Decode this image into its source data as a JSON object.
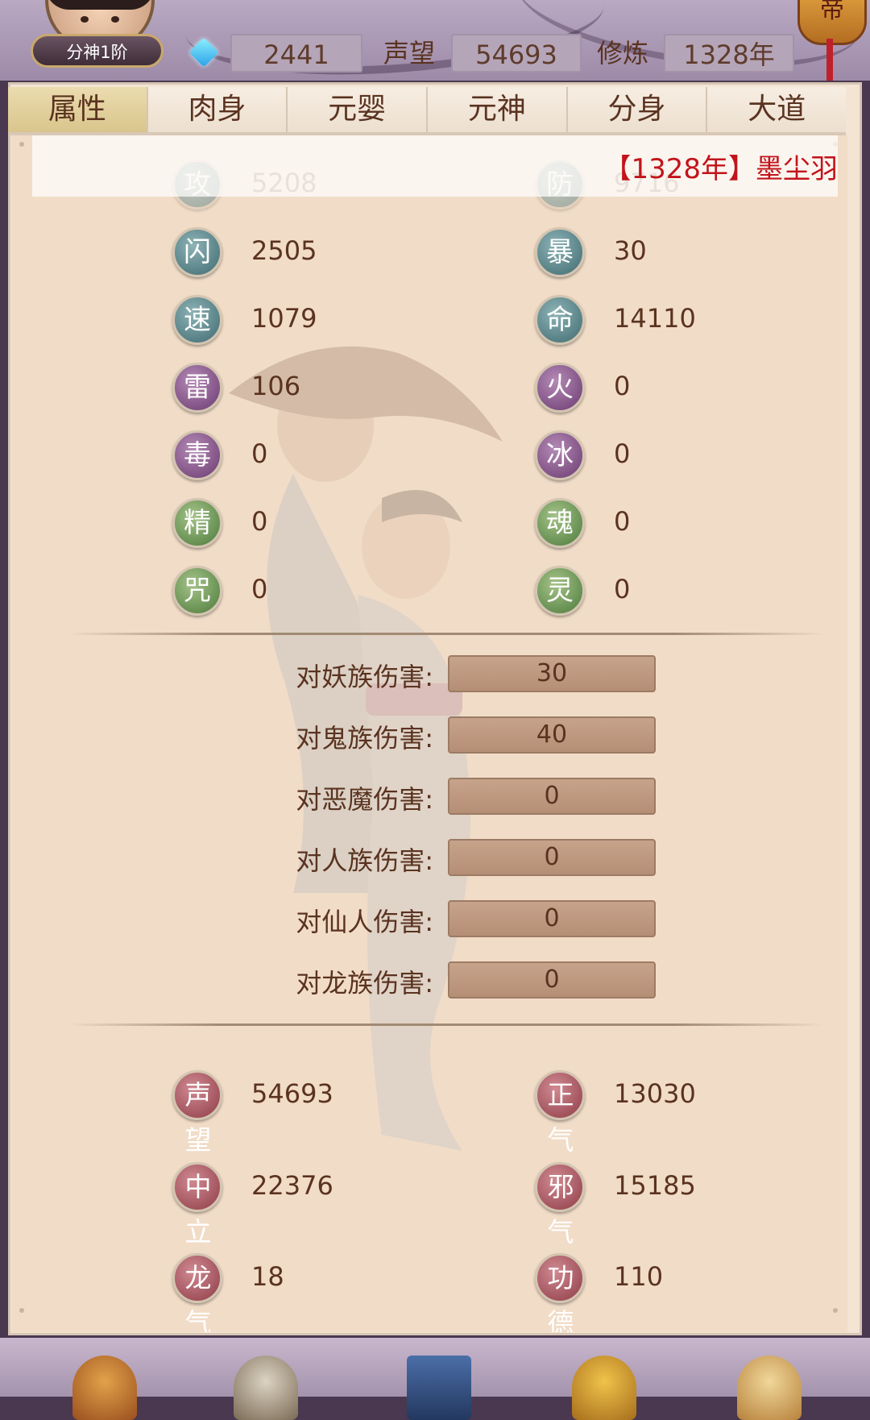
{
  "header": {
    "rank_badge": "分神1阶",
    "gems": "2441",
    "prestige_label": "声望",
    "prestige_value": "54693",
    "cultivation_label": "修炼",
    "cultivation_value": "1328年",
    "lantern_text": "帝"
  },
  "tabs": [
    {
      "label": "属性",
      "active": true
    },
    {
      "label": "肉身",
      "active": false
    },
    {
      "label": "元婴",
      "active": false
    },
    {
      "label": "元神",
      "active": false
    },
    {
      "label": "分身",
      "active": false
    },
    {
      "label": "大道",
      "active": false
    }
  ],
  "ticker": "【1328年】墨尘羽",
  "stats": [
    {
      "icon": "攻",
      "value": "5208",
      "color": "teal"
    },
    {
      "icon": "防",
      "value": "9716",
      "color": "teal"
    },
    {
      "icon": "闪",
      "value": "2505",
      "color": "teal"
    },
    {
      "icon": "暴",
      "value": "30",
      "color": "teal"
    },
    {
      "icon": "速",
      "value": "1079",
      "color": "teal"
    },
    {
      "icon": "命",
      "value": "14110",
      "color": "teal"
    },
    {
      "icon": "雷",
      "value": "106",
      "color": "purple"
    },
    {
      "icon": "火",
      "value": "0",
      "color": "purple"
    },
    {
      "icon": "毒",
      "value": "0",
      "color": "purple"
    },
    {
      "icon": "冰",
      "value": "0",
      "color": "purple"
    },
    {
      "icon": "精",
      "value": "0",
      "color": "green"
    },
    {
      "icon": "魂",
      "value": "0",
      "color": "green"
    },
    {
      "icon": "咒",
      "value": "0",
      "color": "green"
    },
    {
      "icon": "灵",
      "value": "0",
      "color": "green"
    }
  ],
  "damage": [
    {
      "label": "对妖族伤害:",
      "value": "30"
    },
    {
      "label": "对鬼族伤害:",
      "value": "40"
    },
    {
      "label": "对恶魔伤害:",
      "value": "0"
    },
    {
      "label": "对人族伤害:",
      "value": "0"
    },
    {
      "label": "对仙人伤害:",
      "value": "0"
    },
    {
      "label": "对龙族伤害:",
      "value": "0"
    }
  ],
  "reputation": [
    {
      "icon": "声望",
      "value": "54693"
    },
    {
      "icon": "正气",
      "value": "13030"
    },
    {
      "icon": "中立",
      "value": "22376"
    },
    {
      "icon": "邪气",
      "value": "15185"
    },
    {
      "icon": "龙气",
      "value": "18"
    },
    {
      "icon": "功德",
      "value": "110"
    }
  ],
  "colors": {
    "teal": "#3e6a70",
    "purple": "#6b3a70",
    "green": "#4b7a3a",
    "red": "#8e3c46",
    "text_brown": "#5a3320",
    "ticker_red": "#c2141b"
  }
}
